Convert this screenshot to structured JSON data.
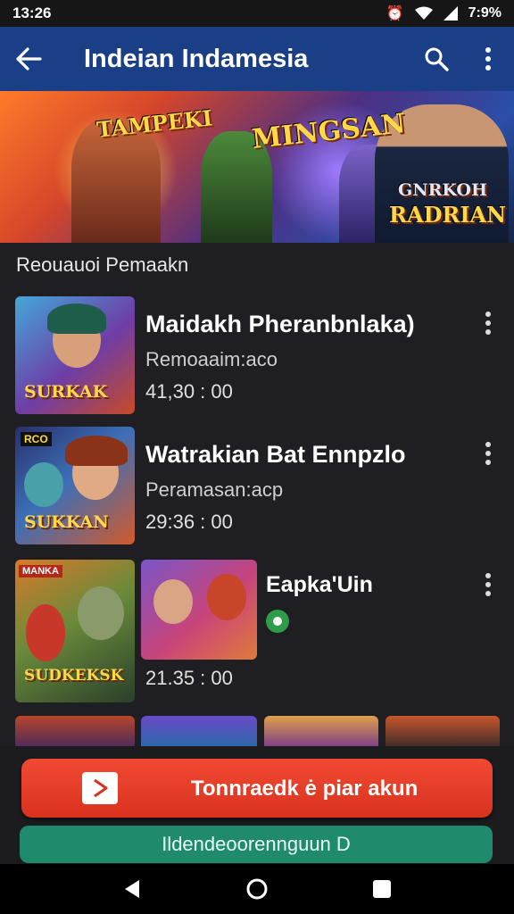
{
  "status_bar": {
    "time": "13:26",
    "battery": "7:9%"
  },
  "app_bar": {
    "title": "Indeian Indamesia"
  },
  "banner": {
    "text_left": "TAMPEKI",
    "text_center": "MINGSAN",
    "text_right_1": "GNRKOH",
    "text_right_2": "RADRIAN"
  },
  "section": {
    "title": "Reouauoi Pemaakn"
  },
  "items": [
    {
      "title": "Maidakh Pheranbnlaka)",
      "subtitle": "Remoaaim:aco",
      "time": "41,30 : 00",
      "logo": "SURKAK"
    },
    {
      "title": "Watrakian Bat Ennpzlo",
      "subtitle": "Peramasan:acp",
      "time": "29:36 : 00",
      "logo": "SUKKAN",
      "tag": "RCO"
    },
    {
      "title": "Eapka'Uin",
      "subtitle": "",
      "time": "21.35 : 00",
      "logo": "SUDKEKSK",
      "tag": "MANKA"
    }
  ],
  "actions": {
    "primary_label": "Tonnraedk ė piar akun",
    "secondary_label": "Ildendeoorennguun D"
  },
  "colors": {
    "app_bar": "#1a3f86",
    "primary": "#e13c26",
    "secondary": "#1f8a6c",
    "background": "#1f1f23"
  }
}
